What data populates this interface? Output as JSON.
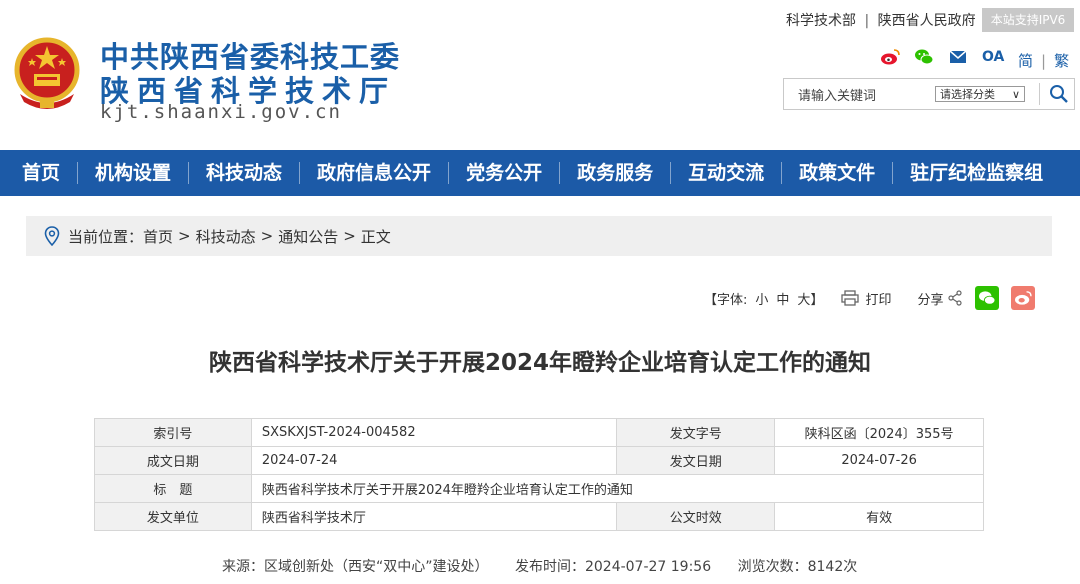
{
  "header": {
    "title_line1": "中共陕西省委科技工委",
    "title_line2": "陕西省科学技术厅",
    "domain": "kjt.shaanxi.gov.cn",
    "top_link1": "科学技术部",
    "top_sep": "|",
    "top_link2": "陕西省人民政府",
    "ipv6_badge": "本站支持IPV6",
    "oa_label": "OA",
    "lang_simplified": "简",
    "lang_sep": "|",
    "lang_traditional": "繁",
    "search": {
      "placeholder": "请输入关键词",
      "category_select": "请选择分类",
      "category_arrow": "∨"
    }
  },
  "nav": {
    "items": [
      "首页",
      "机构设置",
      "科技动态",
      "政府信息公开",
      "党务公开",
      "政务服务",
      "互动交流",
      "政策文件",
      "驻厅纪检监察组"
    ]
  },
  "breadcrumb": {
    "prefix": "当前位置：",
    "items": [
      "首页",
      "科技动态",
      "通知公告",
      "正文"
    ],
    "sep": ">"
  },
  "tools": {
    "font_label": "【字体:",
    "font_small": "小",
    "font_medium": "中",
    "font_large": "大",
    "font_close": "】",
    "print_label": "打印",
    "share_label": "分享"
  },
  "article": {
    "title": "陕西省科学技术厅关于开展2024年瞪羚企业培育认定工作的通知"
  },
  "meta": {
    "index_label": "索引号",
    "index_value": "SXSKXJST-2024-004582",
    "docno_label": "发文字号",
    "docno_value": "陕科区函〔2024〕355号",
    "created_label": "成文日期",
    "created_value": "2024-07-24",
    "issued_label": "发文日期",
    "issued_value": "2024-07-26",
    "title_label": "标　题",
    "title_value": "陕西省科学技术厅关于开展2024年瞪羚企业培育认定工作的通知",
    "unit_label": "发文单位",
    "unit_value": "陕西省科学技术厅",
    "validity_label": "公文时效",
    "validity_value": "有效"
  },
  "footer": {
    "source": "来源：区域创新处（西安“双中心”建设处）",
    "published": "发布时间：2024-07-27 19:56",
    "views": "浏览次数：8142次"
  },
  "colors": {
    "brand_blue": "#1c5aa7",
    "wechat_green": "#2dc100",
    "weibo_red": "#e6162d"
  },
  "icons": [
    "national-emblem-icon",
    "weibo-icon",
    "wechat-icon",
    "mail-icon",
    "search-icon",
    "location-pin-icon",
    "print-icon",
    "share-icon"
  ]
}
